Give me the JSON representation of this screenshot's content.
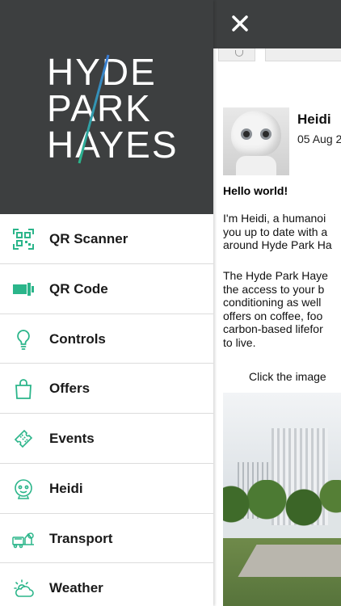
{
  "app": {
    "logo_lines": [
      "HYDE",
      "PARK",
      "HAYES"
    ],
    "close_icon": "close-icon",
    "accent_color": "#2bb58a",
    "header_color": "#3d3f40"
  },
  "menu": {
    "items": [
      {
        "label": "QR Scanner",
        "icon": "qr-scanner-icon"
      },
      {
        "label": "QR Code",
        "icon": "qr-code-icon"
      },
      {
        "label": "Controls",
        "icon": "lightbulb-icon"
      },
      {
        "label": "Offers",
        "icon": "shopping-bag-icon"
      },
      {
        "label": "Events",
        "icon": "ticket-icon"
      },
      {
        "label": "Heidi",
        "icon": "robot-face-icon"
      },
      {
        "label": "Transport",
        "icon": "transport-icon"
      },
      {
        "label": "Weather",
        "icon": "weather-icon"
      }
    ]
  },
  "content": {
    "poster_name": "Heidi",
    "poster_date": "05 Aug 2",
    "greeting": "Hello world!",
    "paragraph1": [
      "I'm Heidi, a humanoi",
      "you up to date with a",
      "around Hyde Park Ha"
    ],
    "paragraph2": [
      "The Hyde Park Haye",
      "the access to your b",
      "conditioning as well",
      "offers on coffee, foo",
      "carbon-based lifefor",
      "to live."
    ],
    "click_text": "Click the image"
  }
}
